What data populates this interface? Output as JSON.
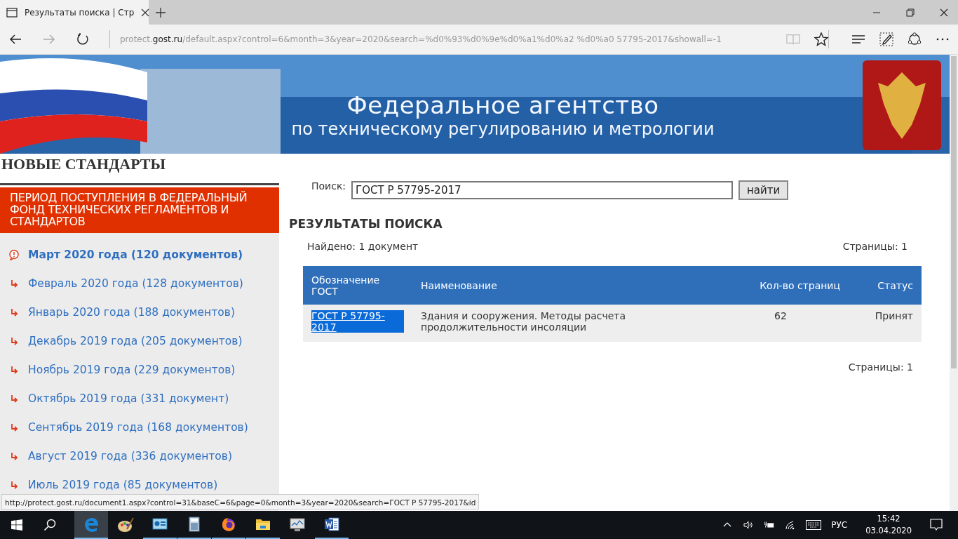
{
  "browser": {
    "tab_title": "Результаты поиска | Стр",
    "address": {
      "prefix": "protect.",
      "host": "gost.ru",
      "path": "/default.aspx?control=6&month=3&year=2020&search=%d0%93%d0%9e%d0%a1%d0%a2 %d0%a0 57795-2017&showall=-1"
    }
  },
  "banner": {
    "title": "Федеральное агентство",
    "subtitle": "по техническому регулированию и метрологии"
  },
  "sidebar": {
    "heading": "НОВЫЕ СТАНДАРТЫ",
    "section_title": "ПЕРИОД ПОСТУПЛЕНИЯ В ФЕДЕРАЛЬНЫЙ ФОНД ТЕХНИЧЕСКИХ РЕГЛАМЕНТОВ И СТАНДАРТОВ",
    "items": [
      {
        "label": "Март 2020 года (120 документов)",
        "selected": true
      },
      {
        "label": "Февраль 2020 года (128 документов)",
        "selected": false
      },
      {
        "label": "Январь 2020 года (188 документов)",
        "selected": false
      },
      {
        "label": "Декабрь 2019 года (205 документов)",
        "selected": false
      },
      {
        "label": "Ноябрь 2019 года (229 документов)",
        "selected": false
      },
      {
        "label": "Октябрь 2019 года (331 документ)",
        "selected": false
      },
      {
        "label": "Сентябрь 2019 года (168 документов)",
        "selected": false
      },
      {
        "label": "Август 2019 года (336 документов)",
        "selected": false
      },
      {
        "label": "Июль 2019 года (85 документов)",
        "selected": false
      }
    ]
  },
  "search": {
    "label": "Поиск:",
    "value": "ГОСТ Р 57795-2017",
    "button": "найти"
  },
  "results": {
    "heading": "РЕЗУЛЬТАТЫ ПОИСКА",
    "found": "Найдено: 1 документ",
    "pages_top": "Страницы: 1",
    "pages_bottom": "Страницы: 1",
    "columns": [
      "Обозначение ГОСТ",
      "Наименование",
      "Кол-во страниц",
      "Статус"
    ],
    "rows": [
      {
        "designation": "ГОСТ Р 57795-2017",
        "selected": true,
        "name": "Здания и сооружения. Методы расчета продолжительности инсоляции",
        "pages": "62",
        "status": "Принят"
      }
    ]
  },
  "status_url": "http://protect.gost.ru/document1.aspx?control=31&baseC=6&page=0&month=3&year=2020&search=ГОСТ Р 57795-2017&id",
  "taskbar": {
    "apps": [
      {
        "kind": "edge",
        "running": true,
        "selected": true
      },
      {
        "kind": "paint",
        "running": false,
        "selected": false
      },
      {
        "kind": "presentation",
        "running": true,
        "selected": false
      },
      {
        "kind": "calculator",
        "running": true,
        "selected": false
      },
      {
        "kind": "firefox",
        "running": true,
        "selected": false
      },
      {
        "kind": "folder",
        "running": true,
        "selected": false
      },
      {
        "kind": "monitor",
        "running": false,
        "selected": false
      },
      {
        "kind": "word",
        "running": true,
        "selected": false
      }
    ],
    "language": "РУС",
    "time": "15:42",
    "date": "03.04.2020"
  }
}
